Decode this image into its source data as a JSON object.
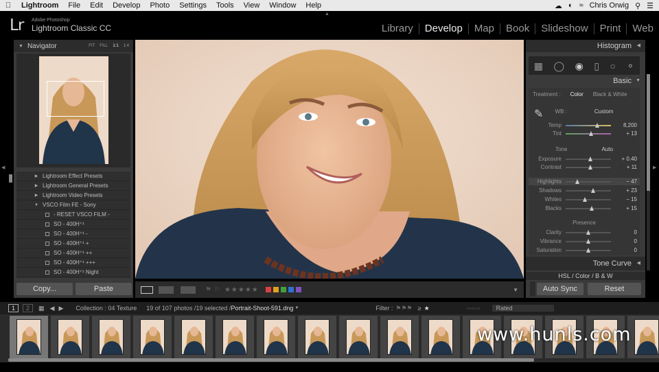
{
  "menubar": {
    "apple": "",
    "items": [
      "Lightroom",
      "File",
      "Edit",
      "Develop",
      "Photo",
      "Settings",
      "Tools",
      "View",
      "Window",
      "Help"
    ],
    "user": "Chris Orwig"
  },
  "app": {
    "logo": "Lr",
    "vendor": "Adobe Photoshop",
    "name": "Lightroom Classic CC"
  },
  "modules": [
    {
      "label": "Library",
      "active": false
    },
    {
      "label": "Develop",
      "active": true
    },
    {
      "label": "Map",
      "active": false
    },
    {
      "label": "Book",
      "active": false
    },
    {
      "label": "Slideshow",
      "active": false
    },
    {
      "label": "Print",
      "active": false
    },
    {
      "label": "Web",
      "active": false
    }
  ],
  "navigator": {
    "title": "Navigator",
    "zoom": [
      "FIT",
      "FILL",
      "1:1",
      "1:4"
    ]
  },
  "presets": [
    {
      "label": "Lightroom Effect Presets",
      "type": "folder",
      "expanded": false
    },
    {
      "label": "Lightroom General Presets",
      "type": "folder",
      "expanded": false
    },
    {
      "label": "Lightroom Video Presets",
      "type": "folder",
      "expanded": false
    },
    {
      "label": "VSCO Film FE - Sony",
      "type": "folder",
      "expanded": true
    },
    {
      "label": "- RESET VSCO FILM -",
      "type": "preset"
    },
    {
      "label": "SO - 400H⁺¹",
      "type": "preset"
    },
    {
      "label": "SO - 400H⁺¹ -",
      "type": "preset"
    },
    {
      "label": "SO - 400H⁺¹ +",
      "type": "preset"
    },
    {
      "label": "SO - 400H⁺¹ ++",
      "type": "preset"
    },
    {
      "label": "SO - 400H⁺¹ +++",
      "type": "preset"
    },
    {
      "label": "SO - 400H⁺¹ Night",
      "type": "preset"
    }
  ],
  "left_buttons": {
    "copy": "Copy...",
    "paste": "Paste"
  },
  "right_panel": {
    "histogram_title": "Histogram",
    "basic_title": "Basic",
    "treatment_label": "Treatment :",
    "treatment_color": "Color",
    "treatment_bw": "Black & White",
    "wb_label": "WB :",
    "wb_value": "Custom",
    "tone_label": "Tone",
    "auto_label": "Auto",
    "presence_label": "Presence",
    "tone_curve_title": "Tone Curve",
    "hsl_title": "HSL / Color / B & W",
    "auto_sync": "Auto Sync",
    "reset": "Reset"
  },
  "sliders": [
    {
      "label": "Temp",
      "value": "8,200",
      "pos": 0.7,
      "group": "wb"
    },
    {
      "label": "Tint",
      "value": "+ 13",
      "pos": 0.56,
      "group": "wb"
    },
    {
      "label": "Exposure",
      "value": "+ 0.40",
      "pos": 0.54,
      "group": "tone"
    },
    {
      "label": "Contrast",
      "value": "+ 11",
      "pos": 0.55,
      "group": "tone"
    },
    {
      "label": "Highlights",
      "value": "− 47",
      "pos": 0.26,
      "group": "tone",
      "highlight": true
    },
    {
      "label": "Shadows",
      "value": "+ 23",
      "pos": 0.61,
      "group": "tone"
    },
    {
      "label": "Whites",
      "value": "− 15",
      "pos": 0.42,
      "group": "tone"
    },
    {
      "label": "Blacks",
      "value": "+ 15",
      "pos": 0.58,
      "group": "tone"
    },
    {
      "label": "Clarity",
      "value": "0",
      "pos": 0.5,
      "group": "presence"
    },
    {
      "label": "Vibrance",
      "value": "0",
      "pos": 0.5,
      "group": "presence"
    },
    {
      "label": "Saturation",
      "value": "0",
      "pos": 0.5,
      "group": "presence"
    }
  ],
  "toolbar": {
    "label_colors": [
      "#d94040",
      "#e0a020",
      "#40a040",
      "#3070d0",
      "#8050c0"
    ],
    "rating_stars": "★★★★★"
  },
  "filmstrip_bar": {
    "page1": "1",
    "page2": "2",
    "collection": "Collection : 04 Texture",
    "count": "19 of 107 photos /19 selected /",
    "filename": "Portrait-Shoot-591.dng",
    "filter_label": "Filter :",
    "rated": "Rated",
    "gte": "≥"
  },
  "watermark": "www.hunls.com",
  "colors": {
    "bg": "#000000",
    "panel": "#3a3a3a",
    "accent": "#ececec"
  }
}
